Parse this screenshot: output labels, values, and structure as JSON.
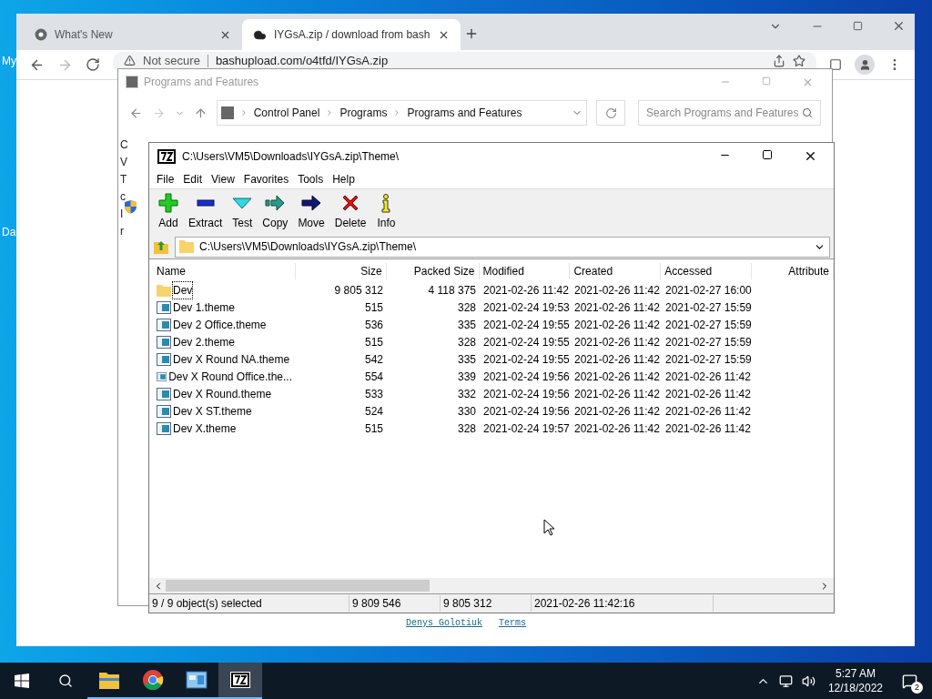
{
  "desktop_icons": [
    {
      "label": "My"
    },
    {
      "label": "Da"
    }
  ],
  "browser": {
    "tabs": [
      {
        "label": "What's New",
        "kind": "chrome",
        "selected": false
      },
      {
        "label": "IYGsA.zip / download from bash",
        "kind": "cloud",
        "selected": true
      }
    ],
    "security": "Not secure",
    "url": "bashupload.com/o4tfd/IYGsA.zip",
    "footer_links": [
      "Denys Golotiuk",
      "Terms"
    ]
  },
  "programs_window": {
    "title": "Programs and Features",
    "breadcrumb": [
      "Control Panel",
      "Programs",
      "Programs and Features"
    ],
    "search": {
      "placeholder": "Search Programs and Features"
    },
    "content_fragments": [
      "C",
      "V",
      "T",
      "c",
      "I",
      "r"
    ]
  },
  "archive_window": {
    "title": "C:\\Users\\VM5\\Downloads\\IYGsA.zip\\Theme\\",
    "menu": [
      "File",
      "Edit",
      "View",
      "Favorites",
      "Tools",
      "Help"
    ],
    "toolbar": [
      {
        "label": "Add",
        "kind": "add"
      },
      {
        "label": "Extract",
        "kind": "extract"
      },
      {
        "label": "Test",
        "kind": "test"
      },
      {
        "label": "Copy",
        "kind": "copy"
      },
      {
        "label": "Move",
        "kind": "move"
      },
      {
        "label": "Delete",
        "kind": "delete"
      },
      {
        "label": "Info",
        "kind": "info"
      }
    ],
    "path": "C:\\Users\\VM5\\Downloads\\IYGsA.zip\\Theme\\",
    "columns": [
      "Name",
      "Size",
      "Packed Size",
      "Modified",
      "Created",
      "Accessed",
      "Attribute"
    ],
    "rows": [
      {
        "kind": "folder",
        "focused": true,
        "cells": [
          "Dev",
          "9 805 312",
          "4 118 375",
          "2021-02-26 11:42",
          "2021-02-26 11:42",
          "2021-02-27 16:00"
        ]
      },
      {
        "kind": "file",
        "focused": false,
        "cells": [
          "Dev 1.theme",
          "515",
          "328",
          "2021-02-24 19:53",
          "2021-02-26 11:42",
          "2021-02-27 15:59"
        ]
      },
      {
        "kind": "file",
        "focused": false,
        "cells": [
          "Dev 2 Office.theme",
          "536",
          "335",
          "2021-02-24 19:55",
          "2021-02-26 11:42",
          "2021-02-27 15:59"
        ]
      },
      {
        "kind": "file",
        "focused": false,
        "cells": [
          "Dev 2.theme",
          "515",
          "328",
          "2021-02-24 19:55",
          "2021-02-26 11:42",
          "2021-02-27 15:59"
        ]
      },
      {
        "kind": "file",
        "focused": false,
        "cells": [
          "Dev X Round NA.theme",
          "542",
          "335",
          "2021-02-24 19:55",
          "2021-02-26 11:42",
          "2021-02-27 15:59"
        ]
      },
      {
        "kind": "file",
        "focused": false,
        "cells": [
          "Dev X Round Office.the...",
          "554",
          "339",
          "2021-02-24 19:56",
          "2021-02-26 11:42",
          "2021-02-26 11:42"
        ]
      },
      {
        "kind": "file",
        "focused": false,
        "cells": [
          "Dev X Round.theme",
          "533",
          "332",
          "2021-02-24 19:56",
          "2021-02-26 11:42",
          "2021-02-26 11:42"
        ]
      },
      {
        "kind": "file",
        "focused": false,
        "cells": [
          "Dev X ST.theme",
          "524",
          "330",
          "2021-02-24 19:56",
          "2021-02-26 11:42",
          "2021-02-26 11:42"
        ]
      },
      {
        "kind": "file",
        "focused": false,
        "cells": [
          "Dev X.theme",
          "515",
          "328",
          "2021-02-24 19:57",
          "2021-02-26 11:42",
          "2021-02-26 11:42"
        ]
      }
    ],
    "status": [
      "9 / 9 object(s) selected",
      "9 809 546",
      "9 805 312",
      "2021-02-26 11:42:16"
    ]
  },
  "taskbar": {
    "apps": [
      {
        "kind": "folder",
        "selected": false
      },
      {
        "kind": "chrome",
        "selected": false
      },
      {
        "kind": "control",
        "selected": false
      },
      {
        "kind": "sevenzip",
        "selected": true
      }
    ],
    "time": "5:27 AM",
    "date": "12/18/2022",
    "notifications": "2"
  }
}
